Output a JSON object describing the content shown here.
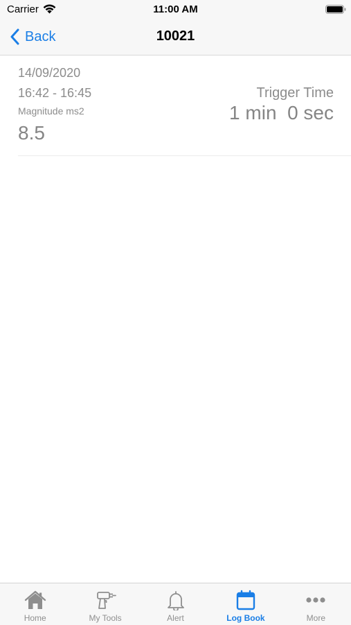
{
  "status_bar": {
    "carrier": "Carrier",
    "time": "11:00 AM"
  },
  "nav": {
    "back_label": "Back",
    "title": "10021"
  },
  "entry": {
    "date": "14/09/2020",
    "time_range": "16:42 - 16:45",
    "magnitude_label": "Magnitude ms2",
    "magnitude_value": "8.5",
    "trigger_label": "Trigger Time",
    "trigger_value": "1 min  0 sec"
  },
  "tabs": [
    {
      "label": "Home",
      "icon": "home-icon"
    },
    {
      "label": "My Tools",
      "icon": "drill-icon"
    },
    {
      "label": "Alert",
      "icon": "bell-icon"
    },
    {
      "label": "Log Book",
      "icon": "calendar-icon"
    },
    {
      "label": "More",
      "icon": "more-dots-icon"
    }
  ],
  "active_tab": "Log Book",
  "colors": {
    "accent": "#1a7ee6",
    "inactive_tab": "#8e8e8e",
    "secondary_text": "#8c8c8c"
  }
}
